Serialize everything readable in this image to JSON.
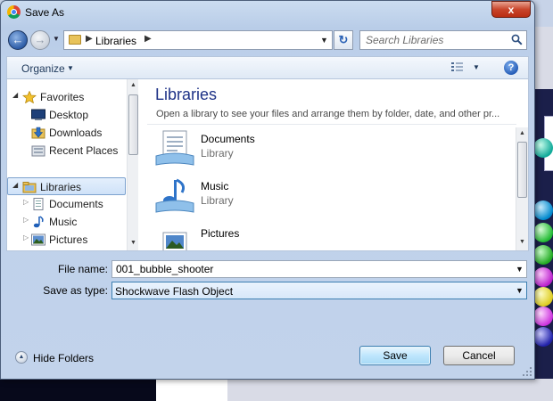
{
  "window": {
    "title": "Save As",
    "close_label": "x"
  },
  "address": {
    "path_label": "Libraries",
    "search_placeholder": "Search Libraries"
  },
  "toolbar": {
    "organize_label": "Organize"
  },
  "nav": {
    "items": [
      {
        "label": "Favorites",
        "icon": "star-icon"
      },
      {
        "label": "Desktop",
        "icon": "desktop-icon"
      },
      {
        "label": "Downloads",
        "icon": "downloads-icon"
      },
      {
        "label": "Recent Places",
        "icon": "recent-places-icon"
      },
      {
        "label": "Libraries",
        "icon": "libraries-icon"
      },
      {
        "label": "Documents",
        "icon": "documents-icon"
      },
      {
        "label": "Music",
        "icon": "music-icon"
      },
      {
        "label": "Pictures",
        "icon": "pictures-icon"
      }
    ]
  },
  "content": {
    "title": "Libraries",
    "subtitle": "Open a library to see your files and arrange them by folder, date, and other pr...",
    "libraries": [
      {
        "name": "Documents",
        "type": "Library",
        "icon": "documents-library-icon"
      },
      {
        "name": "Music",
        "type": "Library",
        "icon": "music-library-icon"
      },
      {
        "name": "Pictures",
        "type": "",
        "icon": "pictures-library-icon"
      }
    ]
  },
  "form": {
    "filename_label": "File name:",
    "filename_value": "001_bubble_shooter",
    "savetype_label": "Save as type:",
    "savetype_value": "Shockwave Flash Object"
  },
  "footer": {
    "hide_folders_label": "Hide Folders",
    "save_label": "Save",
    "cancel_label": "Cancel"
  },
  "colors": {
    "accent": "#1e3287",
    "selection_border": "#3c7fb1",
    "close_red": "#c9462c"
  }
}
